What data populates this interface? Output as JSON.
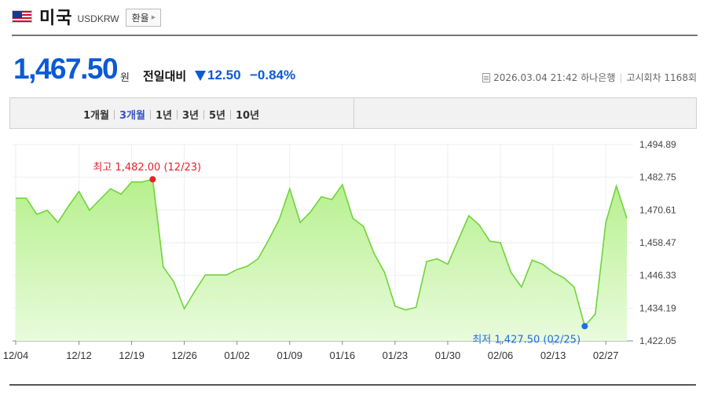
{
  "header": {
    "country": "미국",
    "code": "USDKRW",
    "convert_label": "환율",
    "flag_icon": "us-flag-icon"
  },
  "quote": {
    "price": "1,467.50",
    "unit": "원",
    "vs_label": "전일대비",
    "change": "12.50",
    "change_pct": "−0.84%",
    "direction_icon": "down-triangle-icon",
    "color_down": "#0a5ad6"
  },
  "meta": {
    "datetime": "2026.03.04 21:42",
    "bank": "하나은행",
    "notice": "고시회차 1168회"
  },
  "period_tabs": [
    {
      "label": "1개월",
      "active": false
    },
    {
      "label": "3개월",
      "active": true
    },
    {
      "label": "1년",
      "active": false
    },
    {
      "label": "3년",
      "active": false
    },
    {
      "label": "5년",
      "active": false
    },
    {
      "label": "10년",
      "active": false
    }
  ],
  "chart_data": {
    "type": "area",
    "yticks": [
      "1,494.89",
      "1,482.75",
      "1,470.61",
      "1,458.47",
      "1,446.33",
      "1,434.19",
      "1,422.05"
    ],
    "ylim": [
      1422.05,
      1494.89
    ],
    "xticks": [
      "12/04",
      "12/12",
      "12/19",
      "12/26",
      "01/02",
      "01/09",
      "01/16",
      "01/23",
      "01/30",
      "02/06",
      "02/13",
      "02/27"
    ],
    "grid": true,
    "values": [
      1475.0,
      1475.0,
      1469.0,
      1470.5,
      1466.0,
      1472.0,
      1477.5,
      1470.5,
      1474.5,
      1478.5,
      1476.5,
      1481.0,
      1481.0,
      1482.0,
      1449.5,
      1444.0,
      1434.0,
      1440.5,
      1446.5,
      1446.5,
      1446.5,
      1448.5,
      1449.8,
      1452.5,
      1459.5,
      1467.0,
      1478.5,
      1466.0,
      1470.0,
      1475.5,
      1474.5,
      1480.0,
      1467.5,
      1464.5,
      1454.5,
      1447.5,
      1435.0,
      1433.5,
      1434.5,
      1451.5,
      1452.5,
      1450.5,
      1459.5,
      1468.5,
      1465.0,
      1459.0,
      1458.5,
      1447.5,
      1442.0,
      1452.0,
      1450.5,
      1447.5,
      1445.5,
      1442.0,
      1427.5,
      1432.0,
      1466.0,
      1479.5,
      1467.5
    ],
    "max_label": "최고 1,482.00 (12/23)",
    "min_label": "최저 1,427.50 (02/25)",
    "line_color": "#6fd43c",
    "max_color": "#e8202a",
    "min_color": "#1e6fe0"
  }
}
